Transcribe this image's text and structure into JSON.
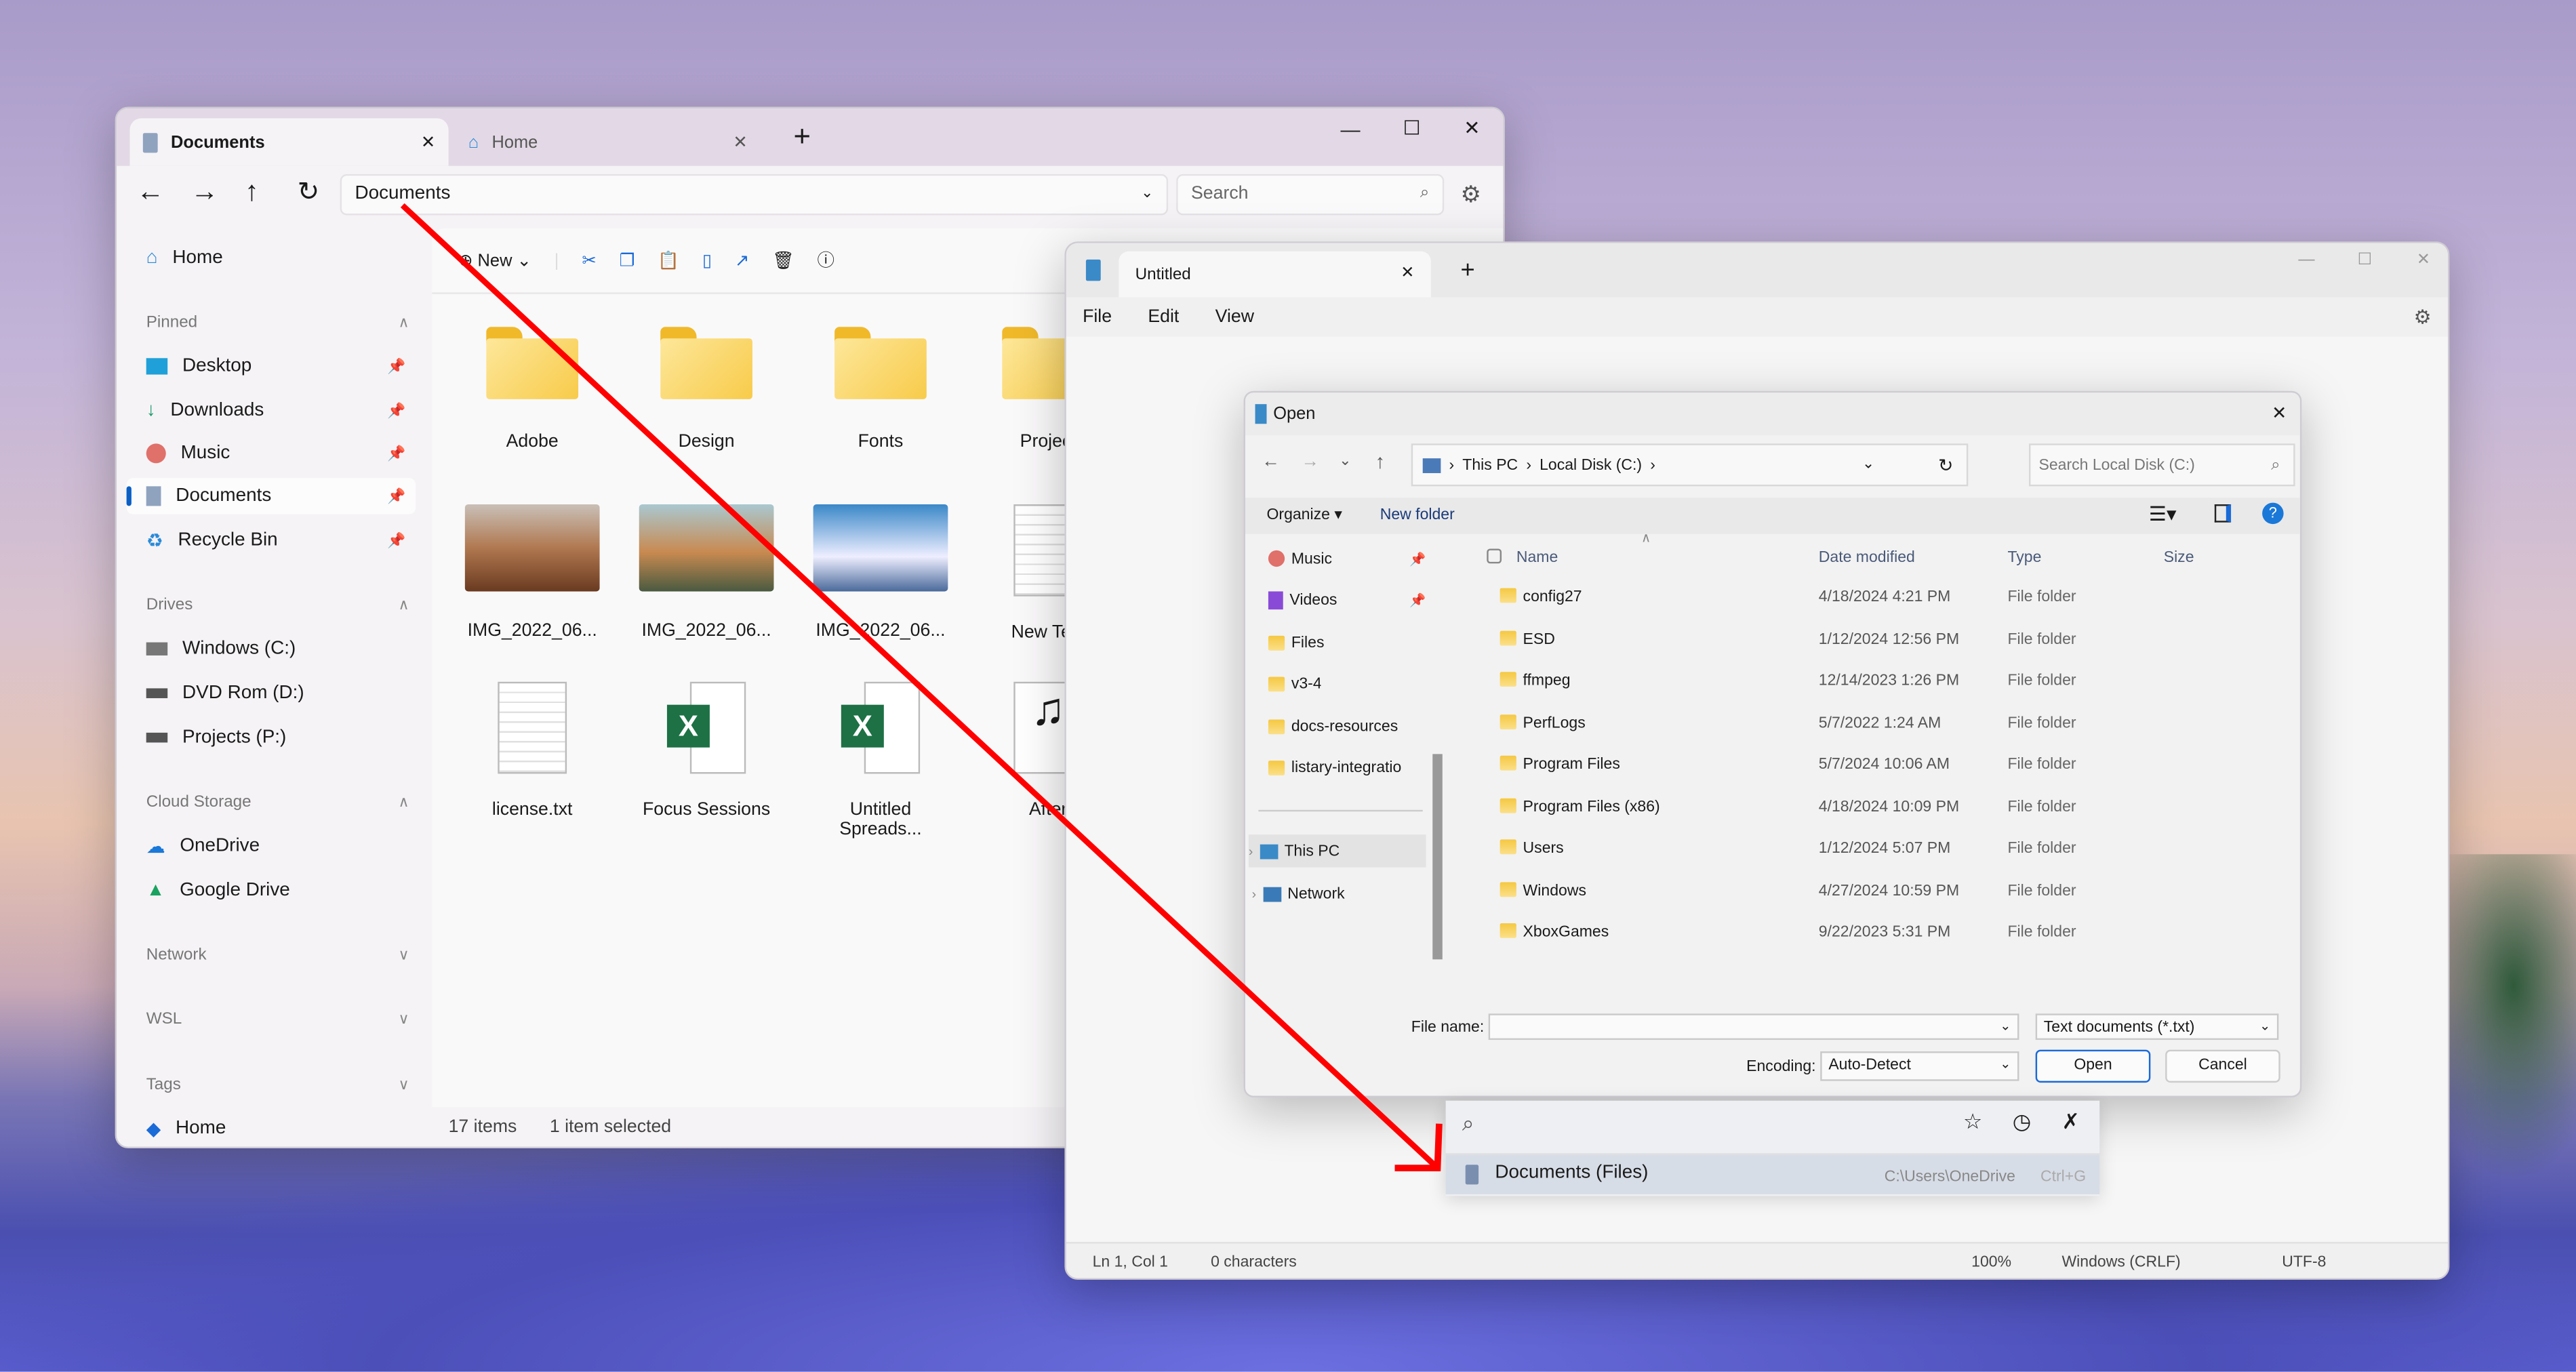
{
  "explorer": {
    "tabs": [
      {
        "label": "Documents",
        "icon": "documents-icon"
      },
      {
        "label": "Home",
        "icon": "home-icon"
      }
    ],
    "address": "Documents",
    "search_placeholder": "Search",
    "new_label": "New",
    "sidebar": {
      "home": "Home",
      "pinned_header": "Pinned",
      "pinned": [
        {
          "label": "Desktop"
        },
        {
          "label": "Downloads"
        },
        {
          "label": "Music"
        },
        {
          "label": "Documents",
          "selected": true
        },
        {
          "label": "Recycle Bin"
        }
      ],
      "drives_header": "Drives",
      "drives": [
        {
          "label": "Windows (C:)"
        },
        {
          "label": "DVD Rom (D:)"
        },
        {
          "label": "Projects (P:)"
        }
      ],
      "cloud_header": "Cloud Storage",
      "cloud": [
        {
          "label": "OneDrive"
        },
        {
          "label": "Google Drive"
        }
      ],
      "network_header": "Network",
      "wsl_header": "WSL",
      "tags_header": "Tags",
      "tags": [
        {
          "label": "Home"
        }
      ]
    },
    "items": [
      {
        "name": "Adobe",
        "kind": "folder"
      },
      {
        "name": "Design",
        "kind": "folder"
      },
      {
        "name": "Fonts",
        "kind": "folder"
      },
      {
        "name": "Project",
        "kind": "folder"
      },
      {
        "name": "IMG_2022_06...",
        "kind": "image"
      },
      {
        "name": "IMG_2022_06...",
        "kind": "image"
      },
      {
        "name": "IMG_2022_06...",
        "kind": "image"
      },
      {
        "name": "New Text",
        "kind": "text"
      },
      {
        "name": "license.txt",
        "kind": "text"
      },
      {
        "name": "Focus Sessions",
        "kind": "excel"
      },
      {
        "name": "Untitled Spreads...",
        "kind": "excel"
      },
      {
        "name": "After",
        "kind": "audio"
      }
    ],
    "status": {
      "count": "17 items",
      "selected": "1 item selected"
    }
  },
  "notepad": {
    "tab": "Untitled",
    "menu": [
      "File",
      "Edit",
      "View"
    ],
    "status": {
      "position": "Ln 1, Col 1",
      "chars": "0 characters",
      "zoom": "100%",
      "line_ending": "Windows (CRLF)",
      "encoding": "UTF-8"
    }
  },
  "open_dialog": {
    "title": "Open",
    "breadcrumb": [
      "This PC",
      "Local Disk (C:)"
    ],
    "search_placeholder": "Search Local Disk (C:)",
    "organize": "Organize",
    "new_folder": "New folder",
    "nav": [
      {
        "label": "Music",
        "pinned": true
      },
      {
        "label": "Videos",
        "pinned": true
      },
      {
        "label": "Files"
      },
      {
        "label": "v3-4"
      },
      {
        "label": "docs-resources"
      },
      {
        "label": "listary-integratio"
      },
      {
        "label": "This PC",
        "selected": true
      },
      {
        "label": "Network"
      }
    ],
    "columns": [
      "Name",
      "Date modified",
      "Type",
      "Size"
    ],
    "rows": [
      {
        "name": "config27",
        "date": "4/18/2024 4:21 PM",
        "type": "File folder"
      },
      {
        "name": "ESD",
        "date": "1/12/2024 12:56 PM",
        "type": "File folder"
      },
      {
        "name": "ffmpeg",
        "date": "12/14/2023 1:26 PM",
        "type": "File folder"
      },
      {
        "name": "PerfLogs",
        "date": "5/7/2022 1:24 AM",
        "type": "File folder"
      },
      {
        "name": "Program Files",
        "date": "5/7/2024 10:06 AM",
        "type": "File folder"
      },
      {
        "name": "Program Files (x86)",
        "date": "4/18/2024 10:09 PM",
        "type": "File folder"
      },
      {
        "name": "Users",
        "date": "1/12/2024 5:07 PM",
        "type": "File folder"
      },
      {
        "name": "Windows",
        "date": "4/27/2024 10:59 PM",
        "type": "File folder"
      },
      {
        "name": "XboxGames",
        "date": "9/22/2023 5:31 PM",
        "type": "File folder"
      }
    ],
    "file_name_label": "File name:",
    "file_name_value": "",
    "file_type": "Text documents (*.txt)",
    "encoding_label": "Encoding:",
    "encoding_value": "Auto-Detect",
    "open_button": "Open",
    "cancel_button": "Cancel"
  },
  "listary": {
    "result_title": "Documents (Files)",
    "result_path": "C:\\Users\\OneDrive",
    "result_shortcut": "Ctrl+G"
  },
  "colors": {
    "arrow": "#ff0000",
    "accent": "#0a5fc4",
    "excel": "#1d7145"
  }
}
